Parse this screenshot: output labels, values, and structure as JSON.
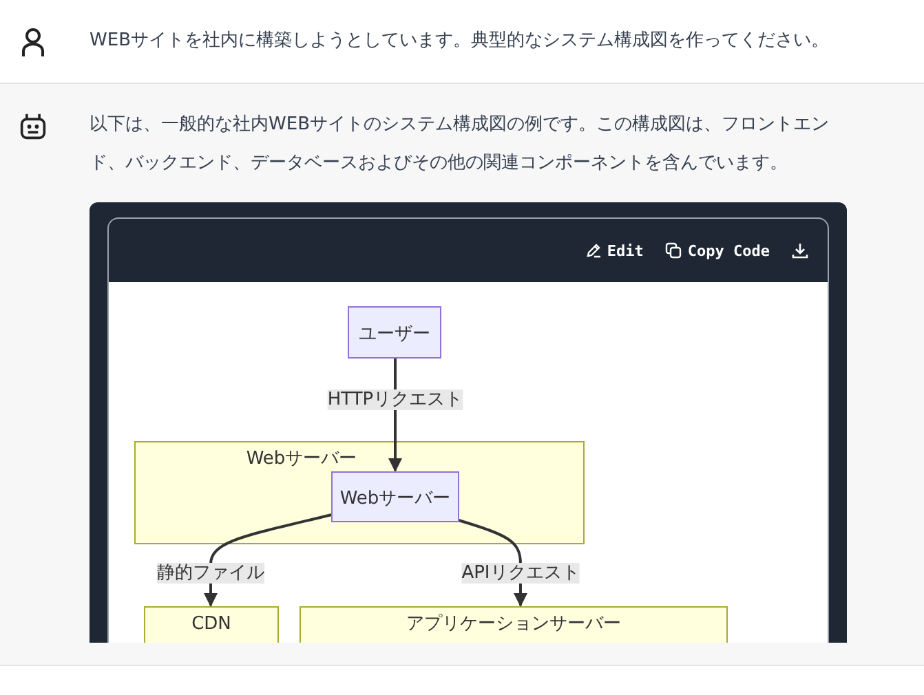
{
  "messages": [
    {
      "kind": "user",
      "text": "WEBサイトを社内に構築しようとしています。典型的なシステム構成図を作ってください。"
    },
    {
      "kind": "assistant",
      "text": "以下は、一般的な社内WEBサイトのシステム構成図の例です。この構成図は、フロントエンド、バックエンド、データベースおよびその他の関連コンポーネントを含んでいます。"
    }
  ],
  "code_block": {
    "actions": [
      {
        "kind": "edit",
        "label": "Edit"
      },
      {
        "kind": "copy",
        "label": "Copy Code"
      },
      {
        "kind": "download"
      }
    ],
    "diagram": {
      "nodes": [
        "ユーザー",
        "Webサーバー"
      ],
      "groups": [
        "Webサーバー",
        "CDN",
        "アプリケーションサーバー"
      ],
      "edges": [
        "HTTPリクエスト",
        "静的ファイル",
        "APIリクエスト"
      ]
    }
  }
}
